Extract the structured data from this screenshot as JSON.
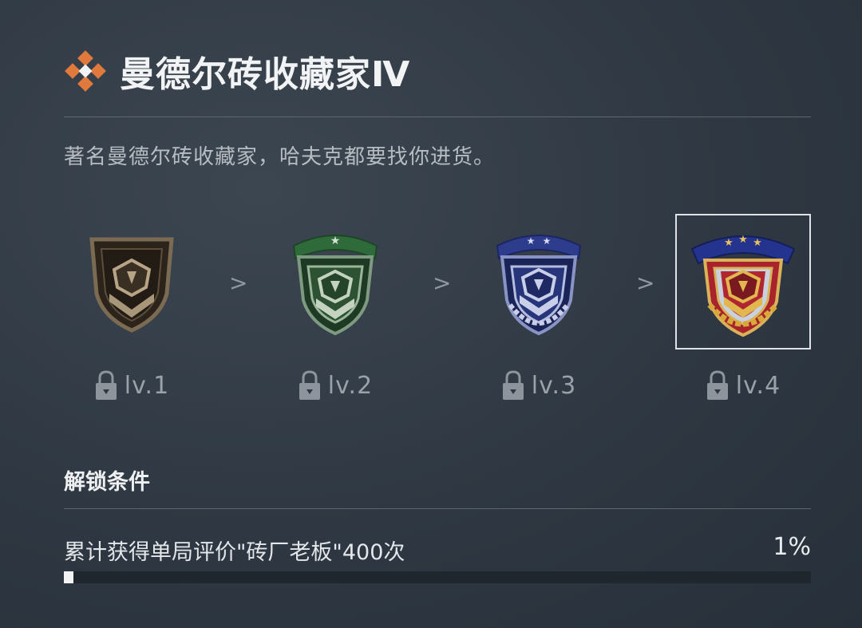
{
  "header": {
    "title": "曼德尔砖收藏家Ⅳ",
    "icon": "diamond-emblem-icon",
    "accent_color": "#e07a3c"
  },
  "description": "著名曼德尔砖收藏家，哈夫克都要找你进货。",
  "badges": [
    {
      "level_label": "lv.1",
      "theme": "bronze",
      "locked": true,
      "selected": false
    },
    {
      "level_label": "lv.2",
      "theme": "green",
      "locked": true,
      "selected": false
    },
    {
      "level_label": "lv.3",
      "theme": "blue",
      "locked": true,
      "selected": false
    },
    {
      "level_label": "lv.4",
      "theme": "gold-red",
      "locked": true,
      "selected": true
    }
  ],
  "arrow_glyph": ">",
  "unlock": {
    "section_title": "解锁条件",
    "condition": "累计获得单局评价\"砖厂老板\"400次",
    "progress_label": "1%",
    "progress_value": 0.01
  }
}
